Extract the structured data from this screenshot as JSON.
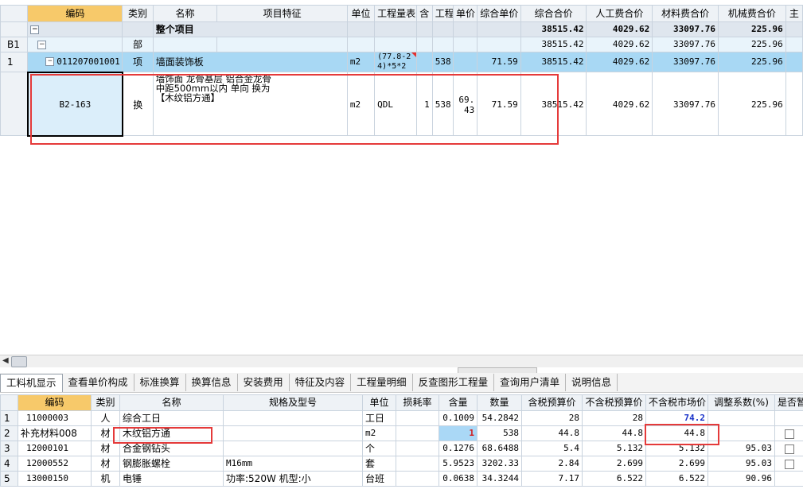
{
  "top_grid": {
    "headers": [
      "编码",
      "类别",
      "名称",
      "项目特征",
      "单位",
      "工程量表",
      "含",
      "工程",
      "单价",
      "综合单价",
      "综合合价",
      "人工费合价",
      "材料费合价",
      "机械费合价",
      "主"
    ],
    "rows": {
      "all": {
        "label": "整个项目",
        "total": "38515.42",
        "labor": "4029.62",
        "material": "33097.76",
        "machine": "225.96"
      },
      "b1": {
        "num": "B1",
        "type": "部",
        "total": "38515.42",
        "labor": "4029.62",
        "material": "33097.76",
        "machine": "225.96"
      },
      "item": {
        "num": "1",
        "code": "011207001001",
        "type": "项",
        "name": "墙面装饰板",
        "unit": "m2",
        "formula": "(77.8-24)*5*2",
        "qty": "538",
        "unit_total": "71.59",
        "total": "38515.42",
        "labor": "4029.62",
        "material": "33097.76",
        "machine": "225.96"
      },
      "sub": {
        "code": "B2-163",
        "type": "换",
        "name": "墙饰面 龙骨基层 铝合金龙骨 中距500mm以内 单向 换为【木纹铝方通】",
        "unit": "m2",
        "formula": "QDL",
        "contains": "1",
        "qty": "538",
        "price": "69.43",
        "unit_total": "71.59",
        "total": "38515.42",
        "labor": "4029.62",
        "material": "33097.76",
        "machine": "225.96"
      }
    }
  },
  "tabs": [
    "工料机显示",
    "查看单价构成",
    "标准换算",
    "换算信息",
    "安装费用",
    "特征及内容",
    "工程量明细",
    "反查图形工程量",
    "查询用户清单",
    "说明信息"
  ],
  "bottom_grid": {
    "headers": [
      "编码",
      "类别",
      "名称",
      "规格及型号",
      "单位",
      "损耗率",
      "含量",
      "数量",
      "含税预算价",
      "不含税预算价",
      "不含税市场价",
      "调整系数(%)",
      "是否暂估"
    ],
    "rows": [
      {
        "num": "1",
        "code": "11000003",
        "type": "人",
        "name": "综合工日",
        "spec": "",
        "unit": "工日",
        "loss": "",
        "content": "0.1009",
        "qty": "54.2842",
        "tax_budget": "28",
        "notax_budget": "28",
        "market": "74.2",
        "coef": "",
        "est": false
      },
      {
        "num": "2",
        "code": "补充材料008",
        "type": "材",
        "name": "木纹铝方通",
        "spec": "",
        "unit": "m2",
        "loss": "",
        "content": "1",
        "qty": "538",
        "tax_budget": "44.8",
        "notax_budget": "44.8",
        "market": "44.8",
        "coef": "",
        "est": true
      },
      {
        "num": "3",
        "code": "12000101",
        "type": "材",
        "name": "合金钢钻头",
        "spec": "",
        "unit": "个",
        "loss": "",
        "content": "0.1276",
        "qty": "68.6488",
        "tax_budget": "5.4",
        "notax_budget": "5.132",
        "market": "5.132",
        "coef": "95.03",
        "est": true
      },
      {
        "num": "4",
        "code": "12000552",
        "type": "材",
        "name": "钢膨胀螺栓",
        "spec": "M16mm",
        "unit": "套",
        "loss": "",
        "content": "5.9523",
        "qty": "3202.33",
        "tax_budget": "2.84",
        "notax_budget": "2.699",
        "market": "2.699",
        "coef": "95.03",
        "est": true
      },
      {
        "num": "5",
        "code": "13000150",
        "type": "机",
        "name": "电锤",
        "spec": "功率:520W 机型:小",
        "unit": "台班",
        "loss": "",
        "content": "0.0638",
        "qty": "34.3244",
        "tax_budget": "7.17",
        "notax_budget": "6.522",
        "market": "6.522",
        "coef": "90.96",
        "est": false
      }
    ]
  },
  "colors": {
    "annotation": "#e53a3a",
    "selected_row": "#a8d8f4",
    "header_highlight": "#f7c96a",
    "market_price": "#1a33c9"
  }
}
